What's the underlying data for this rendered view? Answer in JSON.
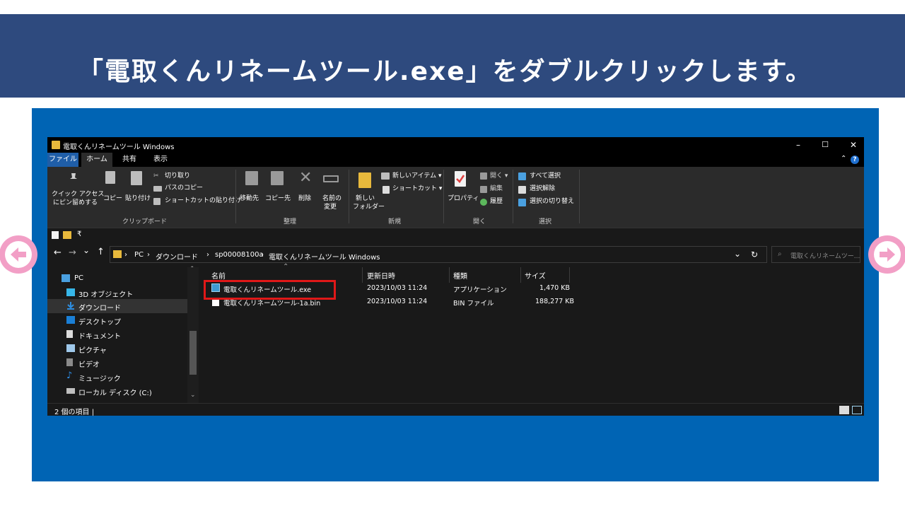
{
  "instruction": {
    "text": "「電取くんリネームツール.exe」をダブルクリックします。"
  },
  "window": {
    "title": "電取くんリネームツール Windows",
    "controls": {
      "minimize": "–",
      "maximize": "☐",
      "close": "✕"
    }
  },
  "menu_tabs": [
    "ファイル",
    "ホーム",
    "共有",
    "表示"
  ],
  "ribbon": {
    "clipboard": {
      "pin_label_1": "クイック アクセス",
      "pin_label_2": "にピン留めする",
      "copy": "コピー",
      "paste": "貼り付け",
      "cut": "切り取り",
      "copy_path": "パスのコピー",
      "paste_shortcut": "ショートカットの貼り付け",
      "group": "クリップボード"
    },
    "organize": {
      "move_to": "移動先",
      "copy_to": "コピー先",
      "delete": "削除",
      "rename_1": "名前の",
      "rename_2": "変更",
      "group": "整理"
    },
    "new": {
      "new_folder_1": "新しい",
      "new_folder_2": "フォルダー",
      "new_item": "新しいアイテム ▾",
      "shortcut": "ショートカット ▾",
      "group": "新規"
    },
    "open": {
      "properties": "プロパティ",
      "open": "開く ▾",
      "edit": "編集",
      "history": "履歴",
      "group": "開く"
    },
    "select": {
      "select_all": "すべて選択",
      "select_none": "選択解除",
      "invert": "選択の切り替え",
      "group": "選択"
    }
  },
  "address_bar": {
    "back": "←",
    "forward": "→",
    "recent": "⌄",
    "up": "↑",
    "crumbs": [
      "PC",
      "ダウンロード",
      "sp00008100a",
      "電取くんリネームツール Windows"
    ],
    "separator": "›",
    "dropdown": "⌄",
    "refresh": "↻",
    "search_placeholder": "電取くんリネームツー..."
  },
  "nav_tree": [
    {
      "label": "PC",
      "icon": "pc-icon",
      "color": "#4aa0e0"
    },
    {
      "label": "3D オブジェクト",
      "icon": "cube-icon",
      "color": "#37b6e8"
    },
    {
      "label": "ダウンロード",
      "icon": "download-icon",
      "color": "#2d8de0"
    },
    {
      "label": "デスクトップ",
      "icon": "desktop-icon",
      "color": "#1a7fd6"
    },
    {
      "label": "ドキュメント",
      "icon": "document-icon",
      "color": "#dcdcdc"
    },
    {
      "label": "ピクチャ",
      "icon": "pictures-icon",
      "color": "#9ec8ea"
    },
    {
      "label": "ビデオ",
      "icon": "video-icon",
      "color": "#8a8a8a"
    },
    {
      "label": "ミュージック",
      "icon": "music-icon",
      "color": "#2f8ee8"
    },
    {
      "label": "ローカル ディスク (C:)",
      "icon": "disk-icon",
      "color": "#bfbfbf"
    }
  ],
  "file_columns": {
    "name": "名前",
    "modified": "更新日時",
    "type": "種類",
    "size": "サイズ"
  },
  "files": [
    {
      "name": "電取くんリネームツール.exe",
      "modified": "2023/10/03 11:24",
      "type": "アプリケーション",
      "size": "1,470 KB"
    },
    {
      "name": "電取くんリネームツール-1a.bin",
      "modified": "2023/10/03 11:24",
      "type": "BIN ファイル",
      "size": "188,277 KB"
    }
  ],
  "status_bar": {
    "text": "2 個の項目 |"
  },
  "colors": {
    "banner": "#2e4a7e",
    "panel": "#0064b4",
    "highlight": "#e01818",
    "nav_arrow": "#f29fc6"
  }
}
